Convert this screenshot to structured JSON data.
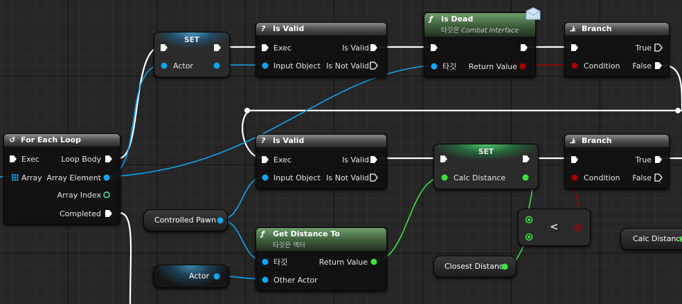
{
  "colors": {
    "exec": "#ffffff",
    "object": "#12a5f0",
    "float": "#3ee23e",
    "bool": "#a30000",
    "header_gray": "#6b6b6b",
    "header_green": "#3d5c3a"
  },
  "for_each_loop": {
    "title": "For Each Loop",
    "icon": "loop-icon",
    "exec": "Exec",
    "array": "Array",
    "loop_body": "Loop Body",
    "array_element": "Array Element",
    "array_index": "Array Index",
    "completed": "Completed"
  },
  "set_actor": {
    "title": "SET",
    "pin": "Actor"
  },
  "is_valid_1": {
    "title": "Is Valid",
    "exec": "Exec",
    "input_object": "Input Object",
    "is_valid": "Is Valid",
    "is_not_valid": "Is Not Valid"
  },
  "is_dead": {
    "title": "Is Dead",
    "subtitle_prefix": "타깃은",
    "subtitle_interface": "Combat Interface",
    "target": "타깃",
    "return_value": "Return Value"
  },
  "branch_1": {
    "title": "Branch",
    "condition": "Condition",
    "true": "True",
    "false": "False"
  },
  "is_valid_2": {
    "title": "Is Valid",
    "exec": "Exec",
    "input_object": "Input Object",
    "is_valid": "Is Valid",
    "is_not_valid": "Is Not Valid"
  },
  "set_distance": {
    "title": "SET",
    "pin": "Calc Distance"
  },
  "branch_2": {
    "title": "Branch",
    "condition": "Condition",
    "true": "True",
    "false": "False"
  },
  "controlled_pawn": {
    "label": "Controlled Pawn"
  },
  "get_distance": {
    "title": "Get Distance To",
    "subtitle": "타깃은 액터",
    "target": "타깃",
    "other_actor": "Other Actor",
    "return_value": "Return Value"
  },
  "actor_getter": {
    "label": "Actor"
  },
  "less_than": {
    "symbol": "<"
  },
  "closest_distance": {
    "label": "Closest Distance"
  },
  "calc_distance_getter": {
    "label": "Calc Distance"
  }
}
